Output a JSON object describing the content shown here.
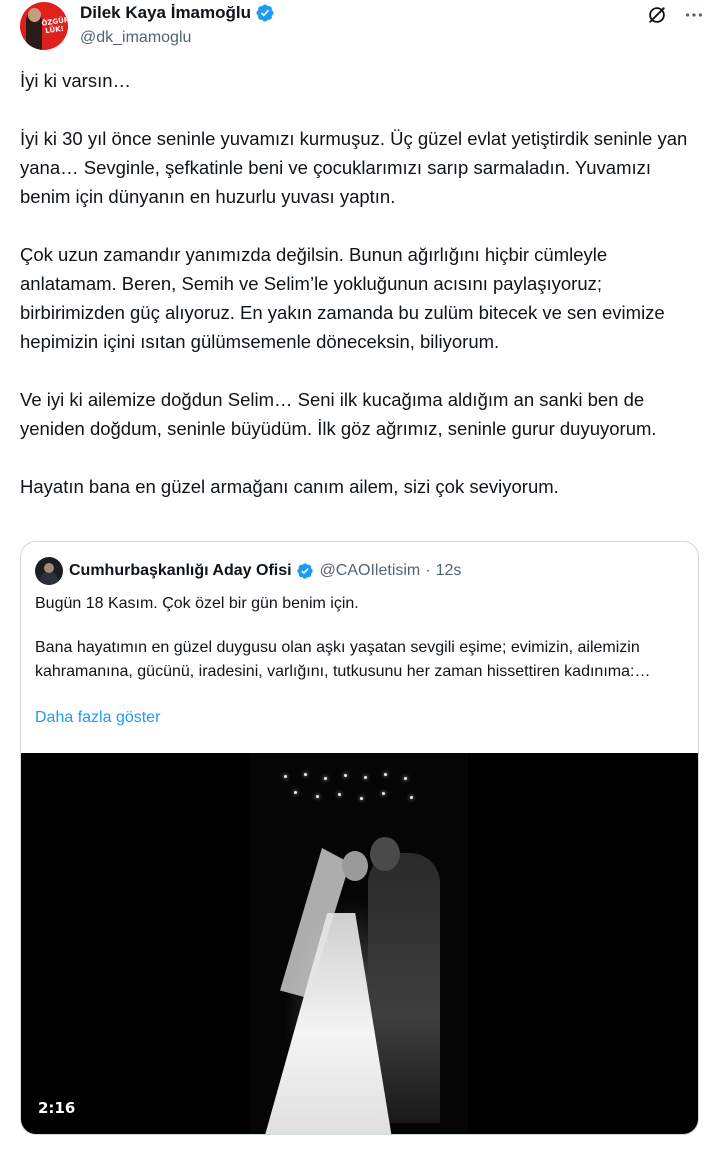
{
  "author": {
    "display_name": "Dilek Kaya İmamoğlu",
    "handle": "@dk_imamoglu",
    "verified_color": "#1d9bf0",
    "avatar_text": "ÖZGÜR-LÜK!"
  },
  "actions": {
    "grok_icon": "grok-slash-circle-icon",
    "more_icon": "ellipsis-icon"
  },
  "tweet": {
    "paragraphs": [
      "İyi ki varsın…",
      "İyi ki 30 yıl önce seninle yuvamızı kurmuşuz. Üç güzel evlat yetiştirdik seninle yan yana… Sevginle, şefkatinle beni ve çocuklarımızı sarıp sarmaladın. Yuvamızı benim için dünyanın en huzurlu yuvası yaptın.",
      "Çok uzun zamandır yanımızda değilsin. Bunun ağırlığını hiçbir cümleyle anlatamam. Beren, Semih ve Selim’le yokluğunun acısını paylaşıyoruz; birbirimizden güç alıyoruz. En yakın zamanda bu zulüm bitecek ve sen evimize hepimizin içini ısıtan gülümsemenle döneceksin, biliyorum.",
      "Ve iyi ki ailemize doğdun Selim… Seni ilk kucağıma aldığım an sanki ben de yeniden doğdum, seninle büyüdüm. İlk göz ağrımız, seninle gurur duyuyorum.",
      "Hayatın bana en güzel armağanı canım ailem, sizi çok seviyorum."
    ]
  },
  "quote": {
    "display_name": "Cumhurbaşkanlığı Aday Ofisi",
    "handle": "@CAOIletisim",
    "separator": "·",
    "time": "12s",
    "text1": "Bugün 18 Kasım. Çok özel bir gün benim için.",
    "text2": "Bana hayatımın en güzel duygusu olan aşkı yaşatan sevgili eşime; evimizin, ailemizin kahramanına, gücünü, iradesini, varlığını, tutkusunu her zaman hissettiren kadınıma:…",
    "show_more": "Daha fazla göster",
    "video_duration": "2:16"
  }
}
